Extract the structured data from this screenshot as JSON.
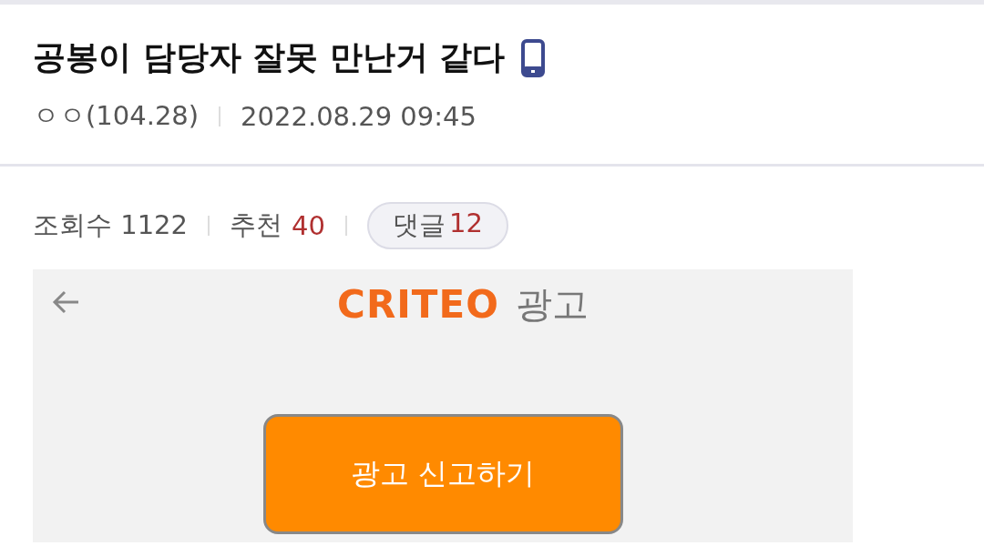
{
  "title": "공봉이 담당자 잘못 만난거 같다",
  "author": "ㅇㅇ(104.28)",
  "date": "2022.08.29 09:45",
  "stats": {
    "views_label": "조회수",
    "views": "1122",
    "recommend_label": "추천",
    "recommend": "40",
    "comments_label": "댓글",
    "comments": "12"
  },
  "ad": {
    "brand": "CRITEO",
    "label": "광고",
    "button": "광고 신고하기"
  }
}
